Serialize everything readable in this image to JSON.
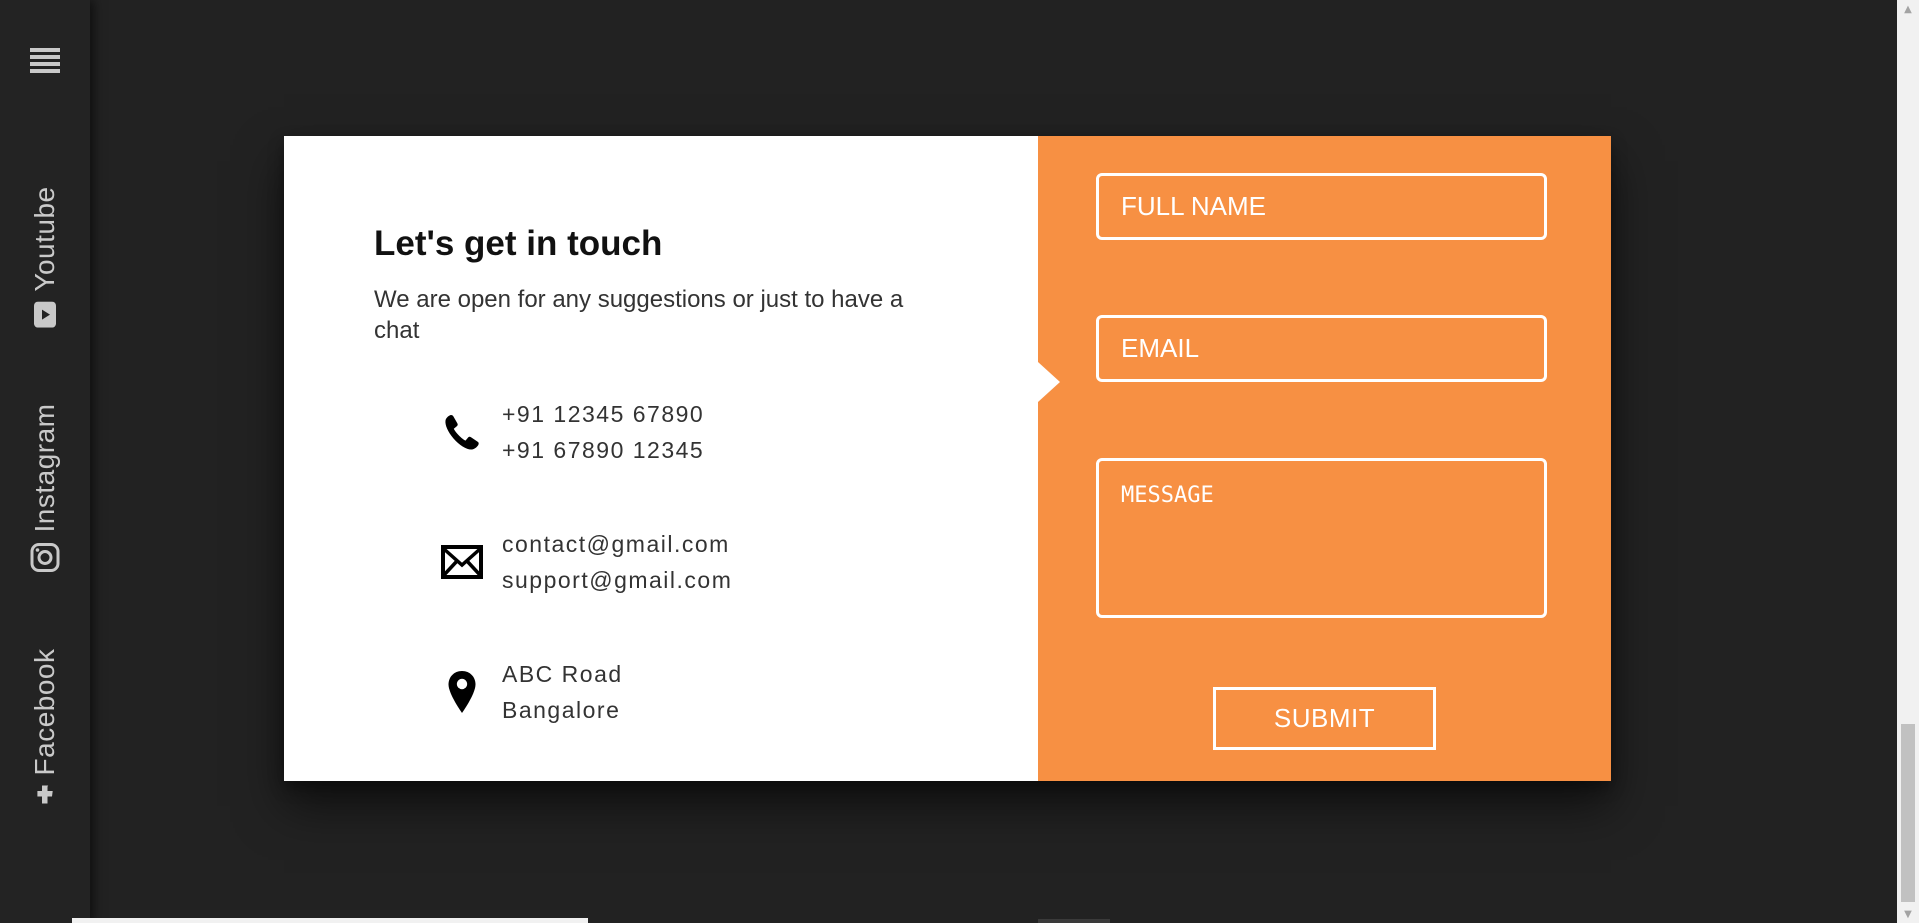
{
  "sidebar": {
    "menu_icon": "hamburger-icon",
    "social_links": [
      {
        "label": "Youtube",
        "icon": "youtube-icon"
      },
      {
        "label": "Instagram",
        "icon": "instagram-icon"
      },
      {
        "label": "Facebook",
        "icon": "facebook-icon"
      }
    ]
  },
  "contact": {
    "heading": "Let's get in touch",
    "subtext": "We are open for any suggestions or just to have a chat",
    "phone": {
      "icon": "phone-icon",
      "lines": [
        "+91 12345 67890",
        "+91 67890 12345"
      ]
    },
    "email": {
      "icon": "envelope-icon",
      "lines": [
        "contact@gmail.com",
        "support@gmail.com"
      ]
    },
    "address": {
      "icon": "location-pin-icon",
      "lines": [
        "ABC Road",
        "Bangalore"
      ]
    }
  },
  "form": {
    "full_name_placeholder": "FULL NAME",
    "email_placeholder": "EMAIL",
    "message_placeholder": "MESSAGE",
    "submit_label": "SUBMIT"
  },
  "colors": {
    "page_bg": "#222222",
    "card_left": "#ffffff",
    "card_right_accent": "#f79043",
    "text_dark": "#111111",
    "sidebar_text": "#c9c9c9"
  }
}
